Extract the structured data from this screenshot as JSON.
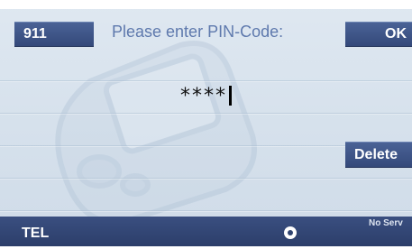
{
  "softkeys": {
    "emergency_label": "911",
    "ok_label": "OK",
    "delete_label": "Delete"
  },
  "prompt": {
    "text": "Please enter PIN-Code:"
  },
  "pin": {
    "masked_value": "****"
  },
  "status_bar": {
    "mode_label": "TEL",
    "network_status": "No Serv"
  },
  "colors": {
    "button_bg": "#3e5588",
    "prompt_text": "#5e79ad",
    "status_bar_bg": "#33477a",
    "background": "#d9e3ee"
  },
  "icons": {
    "nav_indicator": "nav-dot-icon",
    "background_watermark": "phone-icon"
  }
}
